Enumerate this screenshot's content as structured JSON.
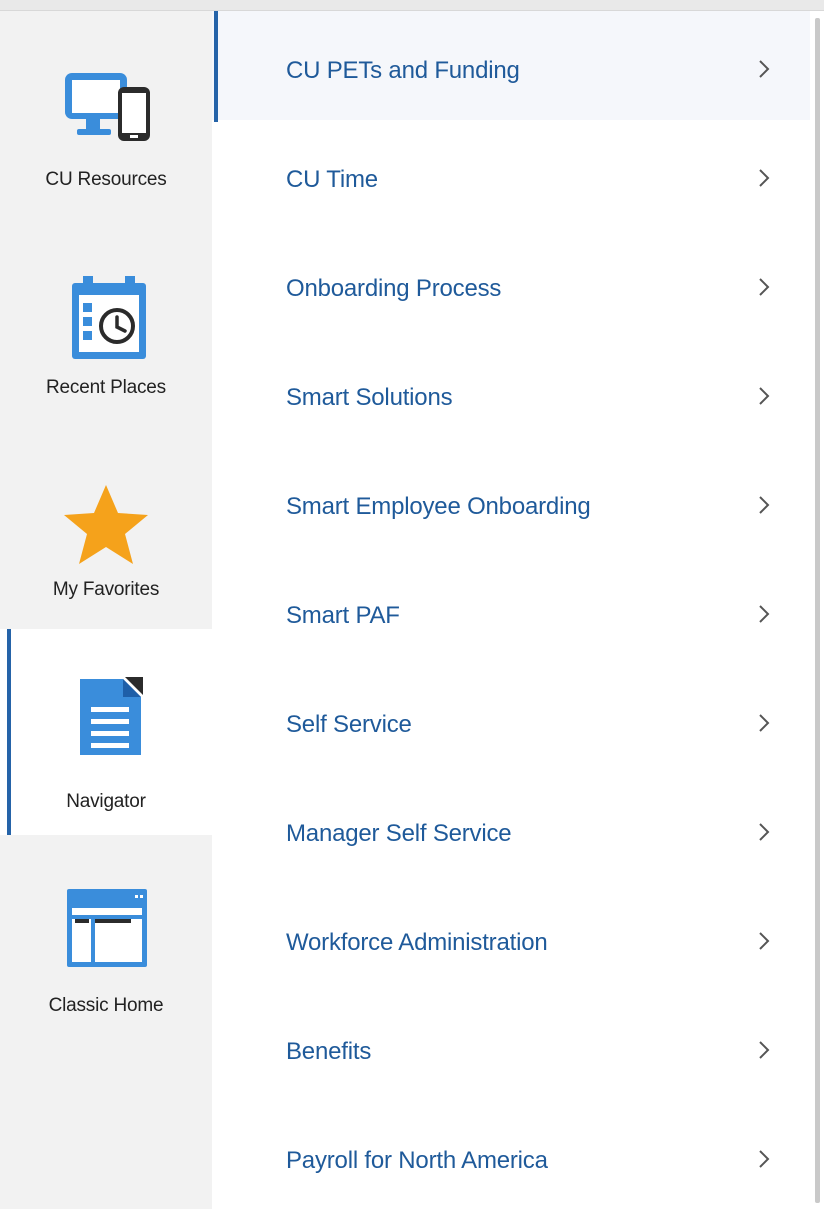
{
  "sidebar": {
    "items": [
      {
        "label": "CU Resources",
        "icon": "monitor-phone-icon"
      },
      {
        "label": "Recent Places",
        "icon": "calendar-clock-icon"
      },
      {
        "label": "My Favorites",
        "icon": "star-icon"
      },
      {
        "label": "Navigator",
        "icon": "document-icon"
      },
      {
        "label": "Classic Home",
        "icon": "window-icon"
      }
    ],
    "active_index": 3
  },
  "menu": {
    "items": [
      {
        "label": "CU PETs and Funding"
      },
      {
        "label": "CU Time"
      },
      {
        "label": "Onboarding Process"
      },
      {
        "label": "Smart Solutions"
      },
      {
        "label": "Smart Employee Onboarding"
      },
      {
        "label": "Smart PAF"
      },
      {
        "label": "Self Service"
      },
      {
        "label": "Manager Self Service"
      },
      {
        "label": "Workforce Administration"
      },
      {
        "label": "Benefits"
      },
      {
        "label": "Payroll for North America"
      }
    ],
    "active_index": 0,
    "chevron_icon": "chevron-right-icon"
  },
  "colors": {
    "accent": "#2563a8",
    "icon_blue": "#3a8ddb",
    "star": "#f5a21b",
    "menu_text": "#1f5a9a",
    "sidebar_bg": "#f2f2f2"
  }
}
